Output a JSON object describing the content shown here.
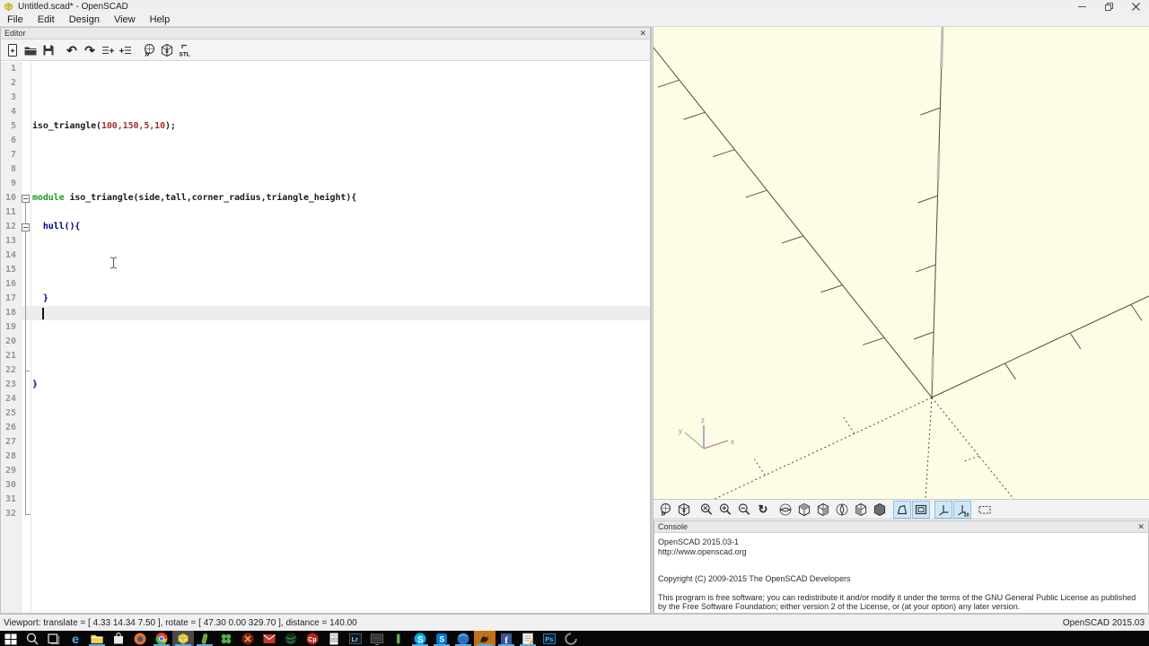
{
  "titlebar": {
    "title": "Untitled.scad* - OpenSCAD",
    "controls": [
      "minimize",
      "restore",
      "close"
    ]
  },
  "menu": {
    "items": [
      "File",
      "Edit",
      "Design",
      "View",
      "Help"
    ]
  },
  "editor": {
    "panel_title": "Editor",
    "close_glyph": "✕",
    "toolbar_icons": [
      "new-file",
      "open-file",
      "save-file",
      "undo",
      "redo",
      "unindent",
      "indent",
      "preview",
      "render",
      "export-stl"
    ],
    "line_count": 32,
    "caret_line": 18,
    "colors": {
      "plain": "#1a1a1a",
      "number": "#a03232",
      "keyword": "#1f9e1f",
      "builtin": "#000080"
    },
    "code_lines": [
      {
        "line": 5,
        "tokens": [
          {
            "text": "iso_triangle(",
            "type": "plain"
          },
          {
            "text": "100,150,5,10",
            "type": "number"
          },
          {
            "text": ");",
            "type": "plain"
          }
        ]
      },
      {
        "line": 10,
        "tokens": [
          {
            "text": "module ",
            "type": "keyword"
          },
          {
            "text": "iso_triangle(side,tall,corner_radius,triangle_height){",
            "type": "plain"
          }
        ]
      },
      {
        "line": 12,
        "tokens": [
          {
            "text": "  hull(){",
            "type": "builtin"
          }
        ]
      },
      {
        "line": 17,
        "tokens": [
          {
            "text": "  }",
            "type": "builtin"
          }
        ]
      },
      {
        "line": 23,
        "tokens": [
          {
            "text": "}",
            "type": "builtin"
          }
        ]
      }
    ],
    "fold_boxes": [
      10,
      12
    ],
    "fold_line": {
      "from_line": 10,
      "to_line": 32,
      "tick_line": 22
    }
  },
  "viewport": {
    "bg_color": "#fdfde6",
    "gizmo_labels": {
      "x": "x",
      "y": "y",
      "z": "z"
    },
    "toolbar_icons": [
      {
        "name": "preview",
        "active": false
      },
      {
        "name": "render",
        "active": false
      },
      {
        "name": "zoom-all",
        "active": false
      },
      {
        "name": "zoom-in",
        "active": false
      },
      {
        "name": "zoom-out",
        "active": false
      },
      {
        "name": "reset-view",
        "active": false
      },
      {
        "name": "view-right",
        "active": false
      },
      {
        "name": "view-top",
        "active": false
      },
      {
        "name": "view-bottom",
        "active": false
      },
      {
        "name": "view-left",
        "active": false
      },
      {
        "name": "view-front",
        "active": false
      },
      {
        "name": "view-back",
        "active": false
      },
      {
        "name": "view-perspective",
        "active": true
      },
      {
        "name": "view-orthogonal",
        "active": true
      },
      {
        "name": "show-axes",
        "active": true
      },
      {
        "name": "show-scale-markers",
        "active": true
      },
      {
        "name": "view-all",
        "active": false
      }
    ]
  },
  "console": {
    "panel_title": "Console",
    "close_glyph": "✕",
    "lines": [
      "OpenSCAD 2015.03-1",
      "http://www.openscad.org",
      "",
      "",
      "Copyright (C) 2009-2015 The OpenSCAD Developers",
      "",
      "This program is free software; you can redistribute it and/or modify it under the terms of the GNU General Public License as published by the Free Software Foundation; either version 2 of the License, or (at your option) any later version."
    ]
  },
  "statusbar": {
    "left": "Viewport: translate = [ 4.33 14.34 7.50 ], rotate = [ 47.30 0.00 329.70 ], distance = 140.00",
    "right": "OpenSCAD 2015.03"
  },
  "taskbar": {
    "icons": [
      {
        "name": "start",
        "underline": false
      },
      {
        "name": "search",
        "underline": false
      },
      {
        "name": "task-view",
        "underline": false
      },
      {
        "name": "edge",
        "underline": false
      },
      {
        "name": "file-explorer",
        "underline": true
      },
      {
        "name": "store",
        "underline": false
      },
      {
        "name": "firefox",
        "underline": false
      },
      {
        "name": "chrome",
        "underline": true
      },
      {
        "name": "openscad",
        "underline": true,
        "active": true
      },
      {
        "name": "green-tool",
        "underline": true
      },
      {
        "name": "clover-app",
        "underline": false
      },
      {
        "name": "red-circle-app",
        "underline": false
      },
      {
        "name": "mail",
        "underline": false
      },
      {
        "name": "globe-app",
        "underline": false
      },
      {
        "name": "corel-app",
        "underline": false
      },
      {
        "name": "calculator",
        "underline": false
      },
      {
        "name": "lightroom",
        "underline": false
      },
      {
        "name": "monitor-app",
        "underline": false
      },
      {
        "name": "small-green-app",
        "underline": false
      },
      {
        "name": "skype",
        "underline": true
      },
      {
        "name": "skype-business",
        "underline": true
      },
      {
        "name": "blue-sphere-app",
        "underline": true
      },
      {
        "name": "attention-app",
        "underline": true,
        "attention": true
      },
      {
        "name": "facebook",
        "underline": true
      },
      {
        "name": "notes-app",
        "underline": true
      },
      {
        "name": "photoshop",
        "underline": false
      },
      {
        "name": "swirl-app",
        "underline": false
      }
    ]
  }
}
